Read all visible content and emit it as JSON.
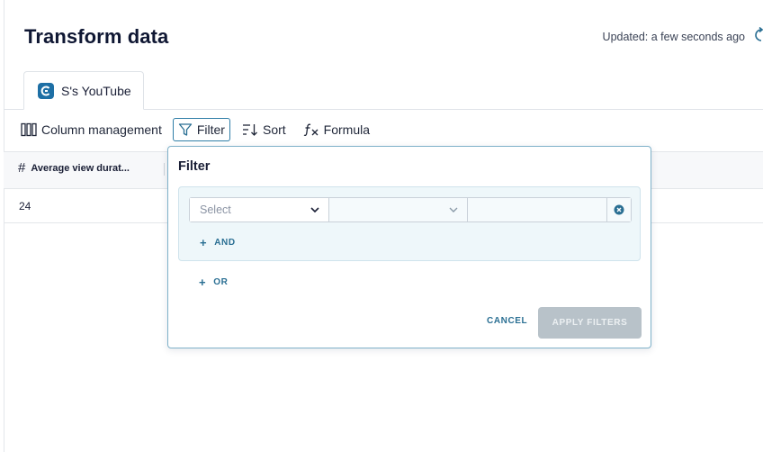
{
  "header": {
    "title": "Transform data",
    "updated": "Updated: a few seconds ago"
  },
  "tabs": [
    {
      "label": "S's YouTube",
      "icon": "source-logo-icon",
      "active": true
    }
  ],
  "toolbar": {
    "column_management": "Column management",
    "filter": "Filter",
    "sort": "Sort",
    "formula": "Formula"
  },
  "grid": {
    "columns": [
      {
        "label": "Average view durat...",
        "type_icon": "#"
      }
    ],
    "rows": [
      [
        "24"
      ]
    ]
  },
  "filter_popover": {
    "title": "Filter",
    "condition": {
      "column_placeholder": "Select",
      "operator_value": "",
      "value": ""
    },
    "and_label": "AND",
    "or_label": "OR",
    "cancel_label": "CANCEL",
    "apply_label": "APPLY FILTERS"
  },
  "colors": {
    "accent": "#2a6f93",
    "brand": "#1d6fa5",
    "apply_disabled": "#b8c2c9"
  }
}
